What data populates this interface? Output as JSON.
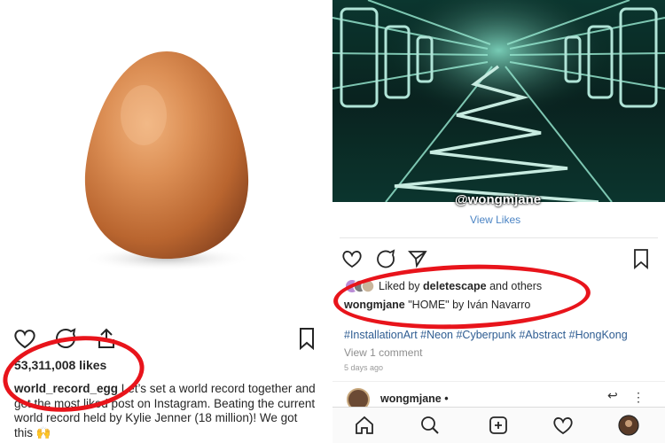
{
  "left_post": {
    "likes": "53,311,008 likes",
    "caption_user": "world_record_egg",
    "caption_text": " Let’s set a world record together and get the most liked post on Instagram. Beating the current world record held by Kylie Jenner (18 million)! We got this 🙌"
  },
  "right_post": {
    "watermark": "@wongmjane",
    "view_likes": "View Likes",
    "liked_by_prefix": "Liked by ",
    "liked_by_user": "deletescape",
    "liked_by_suffix": " and others",
    "caption_user": "wongmjane",
    "caption_text": " \"HOME\" by Iván Navarro",
    "hashtags": "#InstallationArt #Neon #Cyberpunk #Abstract #HongKong",
    "view_comments": "View 1 comment",
    "time_ago": "5 days ago"
  },
  "next_post": {
    "user": "wongmjane •"
  },
  "colors": {
    "highlight": "#e8141b",
    "link": "#2f5d92",
    "muted": "#8e8e8e"
  },
  "icons": [
    "heart-icon",
    "comment-icon",
    "share-icon",
    "bookmark-icon",
    "home-icon",
    "search-icon",
    "add-post-icon",
    "activity-heart-icon",
    "profile-avatar-icon"
  ]
}
